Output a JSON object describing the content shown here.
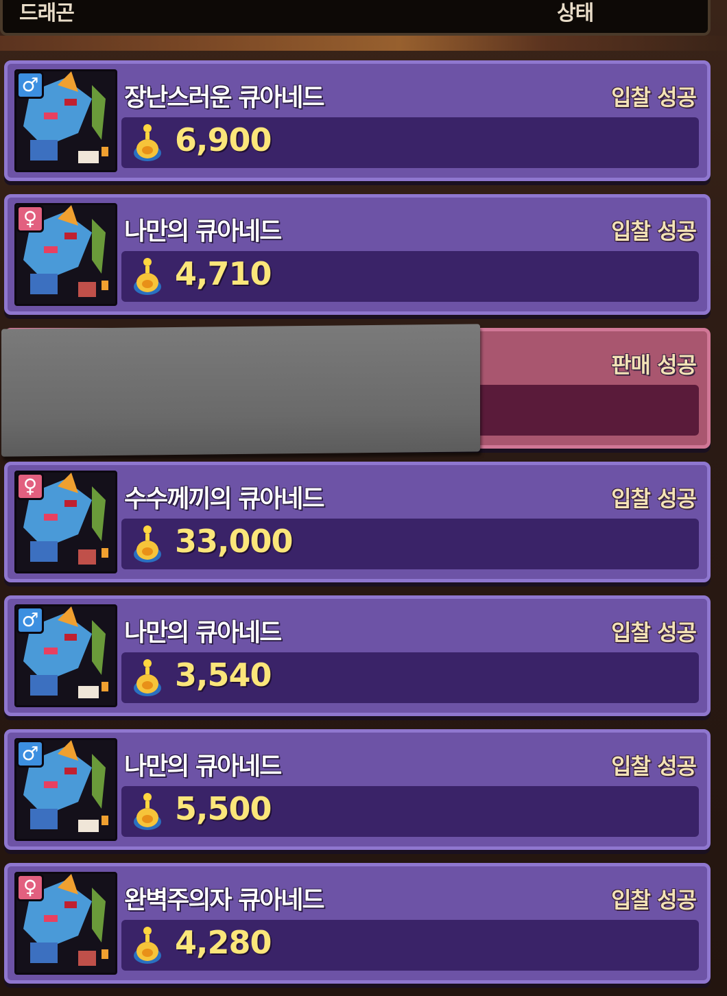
{
  "header": {
    "col_dragon": "드래곤",
    "col_status": "상태"
  },
  "rows": [
    {
      "name": "장난스러운 큐아네드",
      "status": "입찰 성공",
      "price": "6,900",
      "gender": "male",
      "gender_icon": "male-symbol-icon"
    },
    {
      "name": "나만의 큐아네드",
      "status": "입찰 성공",
      "price": "4,710",
      "gender": "female",
      "gender_icon": "female-symbol-icon"
    },
    {
      "name": "",
      "status": "판매 성공",
      "price": "",
      "gender": "",
      "gender_icon": ""
    },
    {
      "name": "수수께끼의 큐아네드",
      "status": "입찰 성공",
      "price": "33,000",
      "gender": "female",
      "gender_icon": "female-symbol-icon"
    },
    {
      "name": "나만의 큐아네드",
      "status": "입찰 성공",
      "price": "3,540",
      "gender": "male",
      "gender_icon": "male-symbol-icon"
    },
    {
      "name": "나만의 큐아네드",
      "status": "입찰 성공",
      "price": "5,500",
      "gender": "male",
      "gender_icon": "male-symbol-icon"
    },
    {
      "name": "완벽주의자 큐아네드",
      "status": "입찰 성공",
      "price": "4,280",
      "gender": "female",
      "gender_icon": "female-symbol-icon"
    }
  ],
  "colors": {
    "row_bg": "#6d53a6",
    "row_border": "#8f77cf",
    "sold_bg": "#a9566f",
    "price_text": "#fbe67a",
    "status_text": "#f3e2b6",
    "male": "#3c8fe0",
    "female": "#e2607f"
  },
  "male_symbol": "♂",
  "female_symbol": "♀"
}
